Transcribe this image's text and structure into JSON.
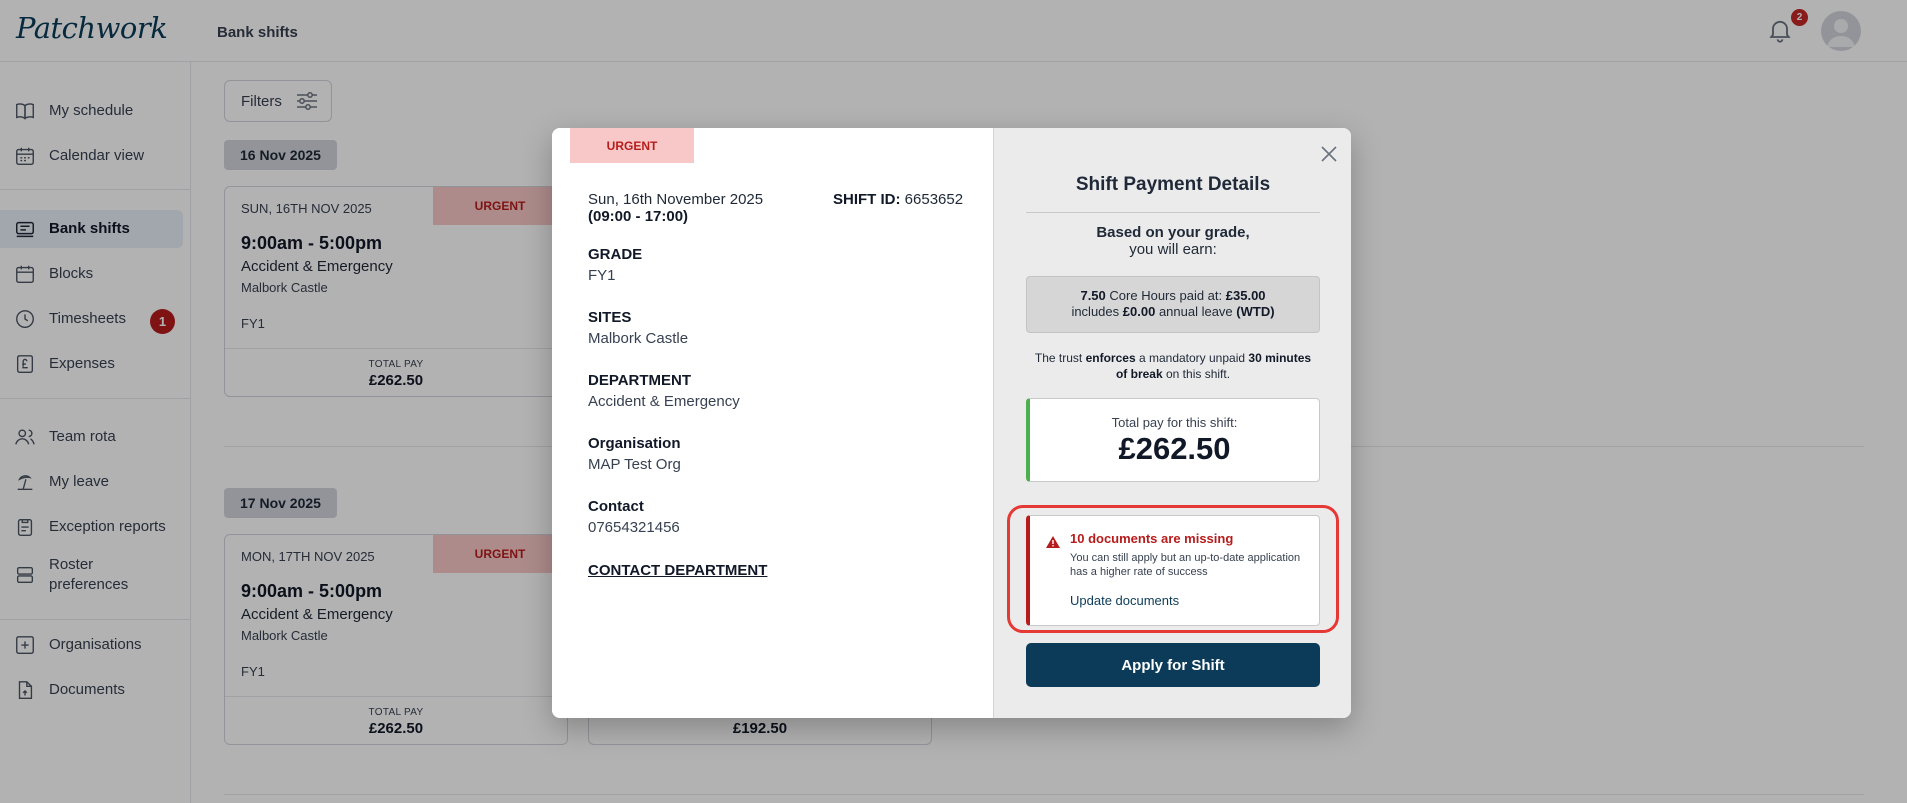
{
  "app": {
    "logo": "Patchwork",
    "page_title": "Bank shifts",
    "notification_count": "2"
  },
  "sidebar": {
    "items": [
      {
        "label": "My schedule",
        "icon": "book-icon"
      },
      {
        "label": "Calendar view",
        "icon": "calendar-icon"
      },
      {
        "label": "Bank shifts",
        "icon": "shifts-icon",
        "active": true
      },
      {
        "label": "Blocks",
        "icon": "blocks-calendar-icon"
      },
      {
        "label": "Timesheets",
        "icon": "clock-icon",
        "badge": "1"
      },
      {
        "label": "Expenses",
        "icon": "pound-receipt-icon"
      },
      {
        "label": "Team rota",
        "icon": "team-icon"
      },
      {
        "label": "My leave",
        "icon": "beach-icon"
      },
      {
        "label": "Exception reports",
        "icon": "clipboard-icon"
      },
      {
        "label": "Roster preferences",
        "icon": "roster-icon"
      },
      {
        "label": "Organisations",
        "icon": "plus-square-icon"
      },
      {
        "label": "Documents",
        "icon": "document-icon"
      }
    ]
  },
  "main": {
    "filters_label": "Filters",
    "groups": [
      {
        "date": "16 Nov 2025",
        "cards": [
          {
            "date": "SUN, 16TH NOV 2025",
            "urgent": "URGENT",
            "time": "9:00am - 5:00pm",
            "department": "Accident & Emergency",
            "site": "Malbork Castle",
            "grade": "FY1",
            "total_label": "TOTAL PAY",
            "total": "£262.50"
          }
        ]
      },
      {
        "date": "17 Nov 2025",
        "cards": [
          {
            "date": "MON, 17TH NOV 2025",
            "urgent": "URGENT",
            "time": "9:00am - 5:00pm",
            "department": "Accident & Emergency",
            "site": "Malbork Castle",
            "grade": "FY1",
            "total_label": "TOTAL PAY",
            "total": "£262.50"
          },
          {
            "total": "£192.50"
          }
        ]
      }
    ]
  },
  "modal": {
    "urgent": "URGENT",
    "date": "Sun, 16th November 2025",
    "time": "(09:00 - 17:00)",
    "shift_id_label": "SHIFT ID:",
    "shift_id": "6653652",
    "fields": [
      {
        "label": "GRADE",
        "value": "FY1"
      },
      {
        "label": "SITES",
        "value": "Malbork Castle"
      },
      {
        "label": "DEPARTMENT",
        "value": "Accident & Emergency"
      },
      {
        "label": "Organisation",
        "value": "MAP Test Org"
      },
      {
        "label": "Contact",
        "value": "07654321456"
      }
    ],
    "contact_department": "CONTACT DEPARTMENT",
    "payment": {
      "title": "Shift Payment Details",
      "subtitle_bold": "Based on your grade,",
      "subtitle": "you will earn:",
      "hours": "7.50",
      "hours_text": "Core Hours paid at:",
      "rate": "£35.00",
      "includes_text": "includes",
      "leave_amount": "£0.00",
      "leave_text": "annual leave",
      "leave_tag": "(WTD)",
      "break_pre": "The trust",
      "break_enforces": "enforces",
      "break_mid": "a mandatory unpaid",
      "break_minutes": "30 minutes of break",
      "break_post": "on this shift.",
      "total_label": "Total pay for this shift:",
      "total": "£262.50",
      "docs_title": "10 documents are missing",
      "docs_desc": "You can still apply but an up-to-date application has a higher rate of success",
      "docs_link": "Update documents",
      "apply": "Apply for Shift"
    }
  },
  "colors": {
    "brand": "#0b3b59",
    "urgent_bg": "#f8c8c8",
    "urgent_text": "#b71c1c",
    "success": "#4caf50",
    "alert_ring": "#e53935",
    "badge": "#b71c1c"
  }
}
